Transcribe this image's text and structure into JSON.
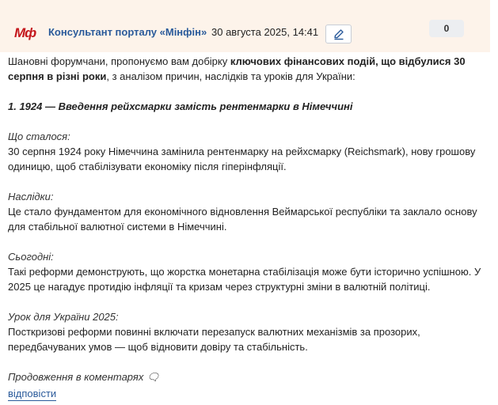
{
  "header": {
    "logo_text": "Мф",
    "author": "Консультант порталу «Мінфін»",
    "date": "30 августа 2025, 14:41",
    "edit_icon": "pencil-icon",
    "counter": "0",
    "colors": {
      "brand": "#c4171c",
      "link": "#2a5a9a",
      "header_bg": "#fdf3ea"
    }
  },
  "post": {
    "intro_start": "Шановні форумчани, пропонуємо вам добірку ",
    "intro_bold": "ключових фінансових подій, що відбулися 30 серпня в різні роки",
    "intro_end": ", з аналізом причин, наслідків та уроків для України:",
    "heading": "1. 1924 — Введення рейхсмарки замість рентенмарки в Німеччині",
    "sections": [
      {
        "label": "Що сталося:",
        "text": "30 серпня 1924 року Німеччина замінила рентенмарку на рейхсмарку (Reichsmark), нову грошову одиницю, щоб стабілізувати економіку після гіперінфляції."
      },
      {
        "label": "Наслідки:",
        "text": "Це стало фундаментом для економічного відновлення Веймарської республіки та заклало основу для стабільної валютної системи в Німеччині."
      },
      {
        "label": "Сьогодні:",
        "text": "Такі реформи демонструють, що жорстка монетарна стабілізація може бути історично успішною. У 2025 це нагадує протидію інфляції та кризам через структурні зміни в валютній політиці."
      },
      {
        "label": "Урок для України 2025:",
        "text": "Посткризові реформи повинні включати перезапуск валютних механізмів за прозорих, передбачуваних умов — щоб відновити довіру та стабільність."
      }
    ],
    "continuation": "Продовження в коментарях 🗨",
    "reply_label": "відповісти"
  }
}
